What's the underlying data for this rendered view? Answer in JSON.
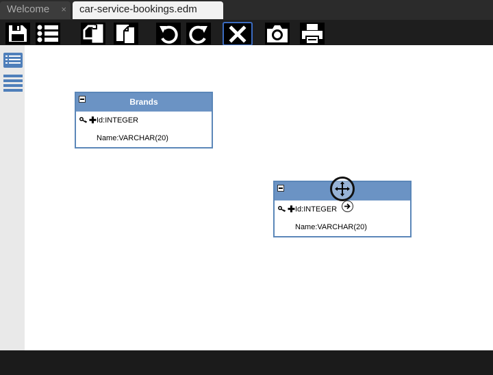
{
  "tabs": [
    {
      "label": "Welcome",
      "close": "×"
    },
    {
      "label": "car-service-bookings.edm"
    }
  ],
  "toolbar": {
    "buttons": [
      {
        "icon": "save-icon"
      },
      {
        "icon": "list-icon"
      },
      {
        "icon": "copy-icon"
      },
      {
        "icon": "paste-icon"
      },
      {
        "icon": "undo-icon"
      },
      {
        "icon": "redo-icon"
      },
      {
        "icon": "delete-icon"
      },
      {
        "icon": "camera-icon"
      },
      {
        "icon": "print-icon"
      }
    ]
  },
  "sidebar": {
    "items": [
      {
        "icon": "entity-list-icon"
      },
      {
        "icon": "menu-lines-icon"
      }
    ]
  },
  "entities": [
    {
      "title": "Brands",
      "fields": [
        {
          "label": "Id:INTEGER",
          "primary_key": true
        },
        {
          "label": "Name:VARCHAR(20)",
          "primary_key": false
        }
      ]
    },
    {
      "title": "",
      "fields": [
        {
          "label": "Id:INTEGER",
          "primary_key": true
        },
        {
          "label": "Name:VARCHAR(20)",
          "primary_key": false
        }
      ]
    }
  ],
  "colors": {
    "header": "#6b93c4",
    "border": "#5a86b8",
    "accent": "#3b6cc2"
  }
}
